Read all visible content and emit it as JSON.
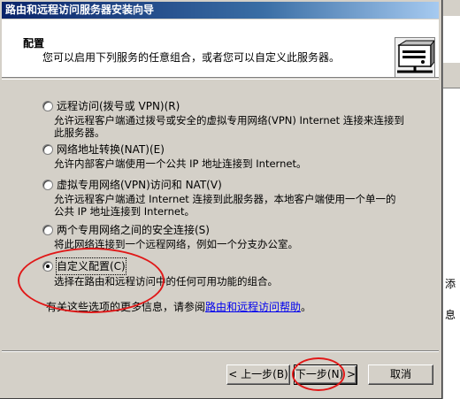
{
  "window": {
    "title": "路由和远程访问服务器安装向导"
  },
  "header": {
    "title": "配置",
    "subtitle": "您可以启用下列服务的任意组合，或者您可以自定义此服务器。",
    "icon": "server-network-icon"
  },
  "options": [
    {
      "label": "远程访问(拨号或 VPN)(R)",
      "desc": [
        "允许远程客户端通过拨号或安全的虚拟专用网络(VPN) Internet 连接来连接到",
        "此服务器。"
      ],
      "checked": false
    },
    {
      "label": "网络地址转换(NAT)(E)",
      "desc": [
        "允许内部客户端使用一个公共 IP 地址连接到 Internet。"
      ],
      "checked": false
    },
    {
      "label": "虚拟专用网络(VPN)访问和 NAT(V)",
      "desc": [
        "允许远程客户端通过 Internet 连接到此服务器，本地客户端使用一个单一的",
        "公共 IP 地址连接到 Internet。"
      ],
      "checked": false
    },
    {
      "label": "两个专用网络之间的安全连接(S)",
      "desc": [
        "将此网络连接到一个远程网络，例如一个分支办公室。"
      ],
      "checked": false
    },
    {
      "label": "自定义配置(C)",
      "desc": [
        "选择在路由和远程访问中的任何可用功能的组合。"
      ],
      "checked": true
    }
  ],
  "info": {
    "prefix": "有关这些选项的更多信息，请参阅",
    "link": "路由和远程访问帮助",
    "suffix": "。"
  },
  "buttons": {
    "back": "< 上一步(B)",
    "next": "下一步(N) >",
    "cancel": "取消"
  },
  "background": {
    "frag1": "添",
    "frag2": "息"
  },
  "colors": {
    "title_start": "#0a246a",
    "title_end": "#a6caf0",
    "annotation": "#e01818",
    "link": "#0000ee"
  }
}
